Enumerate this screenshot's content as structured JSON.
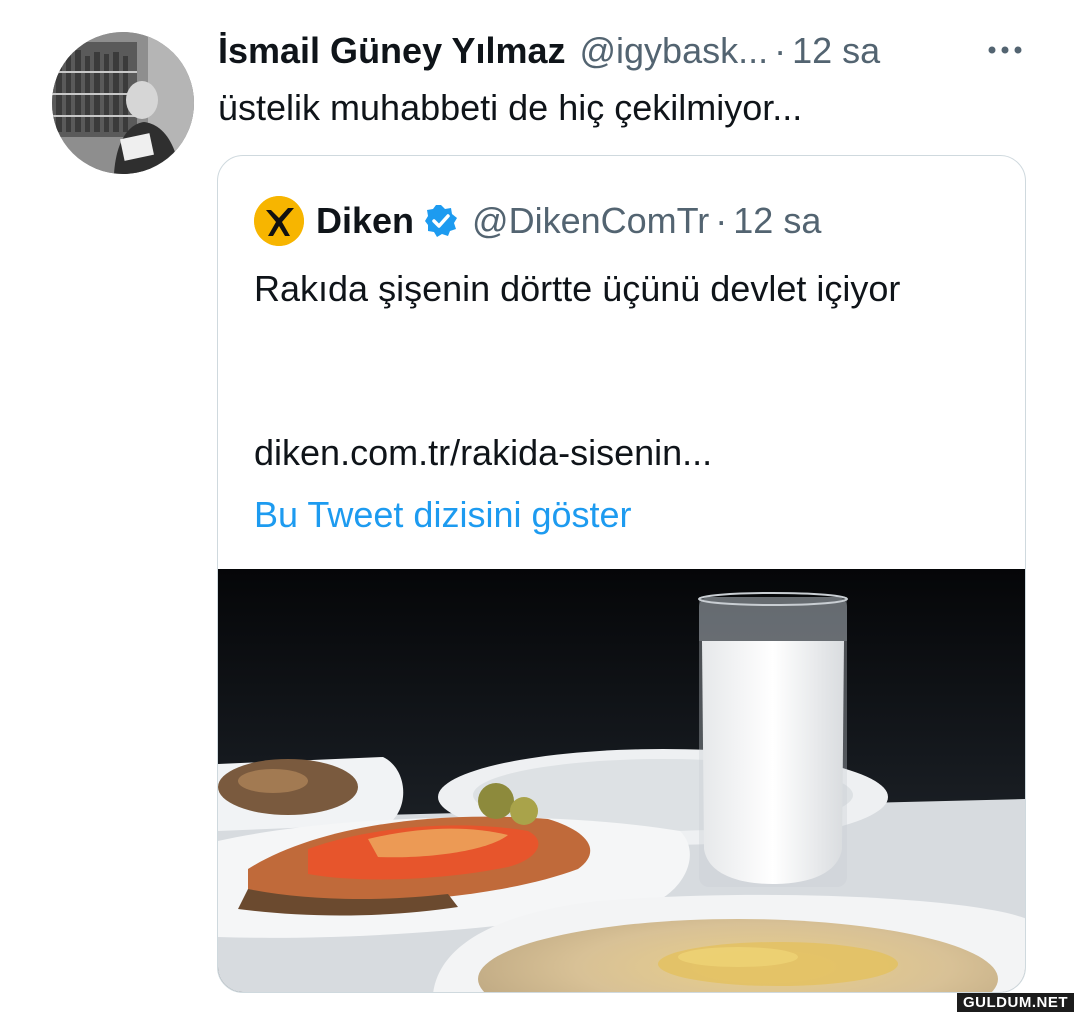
{
  "tweet": {
    "author_name": "İsmail Güney Yılmaz",
    "author_handle": "@igybask...",
    "separator": "·",
    "time": "12 sa",
    "text": "üstelik muhabbeti de hiç çekilmiyor...",
    "more_icon": "more-horizontal-icon"
  },
  "quoted_tweet": {
    "author_name": "Diken",
    "author_handle": "@DikenComTr",
    "separator": "·",
    "time": "12 sa",
    "verified_icon": "verified-badge-icon",
    "verified_color": "#1d9bf0",
    "avatar_color": "#f7b500",
    "text": "Rakıda şişenin dörtte üçünü devlet içiyor",
    "link": "diken.com.tr/rakida-sisenin...",
    "thread_label": "Bu Tweet dizisini göster",
    "thread_color": "#1d9bf0"
  },
  "watermark": "GULDUM.NET"
}
